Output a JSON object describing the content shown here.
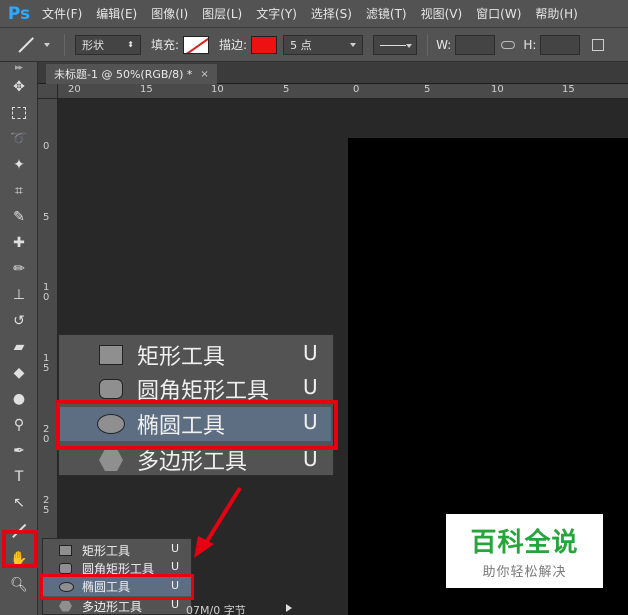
{
  "app": {
    "logo": "Ps"
  },
  "menu": [
    "文件(F)",
    "编辑(E)",
    "图像(I)",
    "图层(L)",
    "文字(Y)",
    "选择(S)",
    "滤镜(T)",
    "视图(V)",
    "窗口(W)",
    "帮助(H)"
  ],
  "options": {
    "mode": "形状",
    "fill_label": "填充:",
    "stroke_label": "描边:",
    "stroke_size": "5 点",
    "w_label": "W:",
    "h_label": "H:",
    "stroke_color": "#ee1111"
  },
  "document": {
    "tab_title": "未标题-1 @ 50%(RGB/8) *",
    "close": "×"
  },
  "ruler": {
    "top": [
      "20",
      "15",
      "10",
      "5",
      "0",
      "5",
      "10",
      "15"
    ],
    "left": [
      "0",
      "5",
      "1\n0",
      "1\n5",
      "2\n0",
      "2\n5"
    ]
  },
  "flyout_large": {
    "items": [
      {
        "label": "矩形工具",
        "shortcut": "U",
        "icon": "rectangle-icon"
      },
      {
        "label": "圆角矩形工具",
        "shortcut": "U",
        "icon": "rounded-rectangle-icon"
      },
      {
        "label": "椭圆工具",
        "shortcut": "U",
        "icon": "ellipse-icon",
        "selected": true
      },
      {
        "label": "多边形工具",
        "shortcut": "U",
        "icon": "polygon-icon"
      }
    ]
  },
  "flyout_small": {
    "items": [
      {
        "label": "矩形工具",
        "shortcut": "U"
      },
      {
        "label": "圆角矩形工具",
        "shortcut": "U"
      },
      {
        "label": "椭圆工具",
        "shortcut": "U",
        "selected": true
      },
      {
        "label": "多边形工具",
        "shortcut": "U"
      }
    ]
  },
  "status": {
    "text": "07M/0 字节"
  },
  "watermark": {
    "title": "百科全说",
    "subtitle": "助你轻松解决"
  },
  "colors": {
    "highlight": "#e60012",
    "selected_row": "#5d6e82",
    "watermark_green": "#27a53a"
  }
}
